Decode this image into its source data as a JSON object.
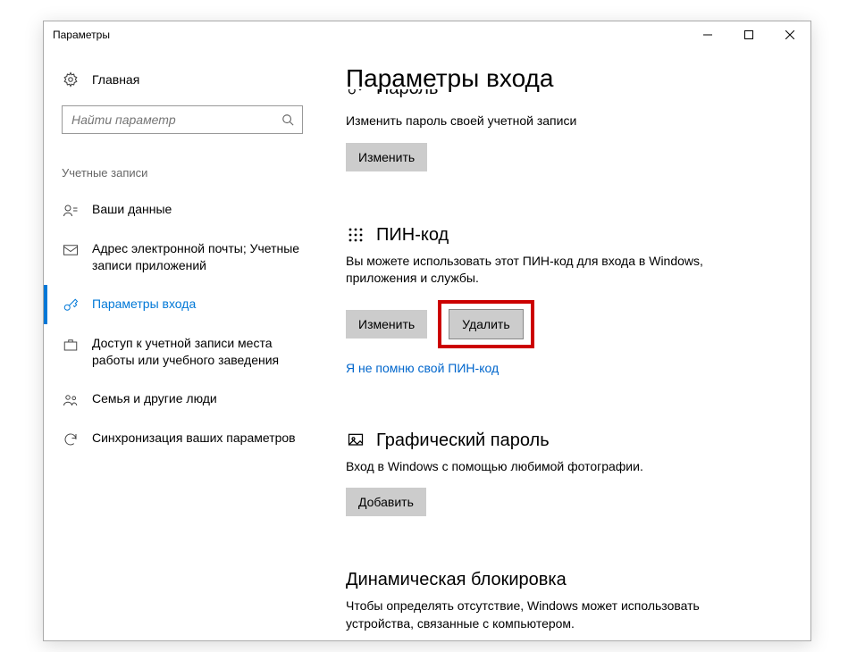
{
  "titlebar": {
    "title": "Параметры"
  },
  "sidebar": {
    "home": "Главная",
    "search_placeholder": "Найти параметр",
    "group": "Учетные записи",
    "items": [
      {
        "label": "Ваши данные"
      },
      {
        "label": "Адрес электронной почты; Учетные записи приложений"
      },
      {
        "label": "Параметры входа"
      },
      {
        "label": "Доступ к учетной записи места работы или учебного заведения"
      },
      {
        "label": "Семья и другие люди"
      },
      {
        "label": "Синхронизация ваших параметров"
      }
    ]
  },
  "main": {
    "page_title": "Параметры входа",
    "password": {
      "heading_partial": "Пароль",
      "desc": "Изменить пароль своей учетной записи",
      "change": "Изменить"
    },
    "pin": {
      "heading": "ПИН-код",
      "desc": "Вы можете использовать этот ПИН-код для входа в Windows, приложения и службы.",
      "change": "Изменить",
      "remove": "Удалить",
      "forgot": "Я не помню свой ПИН-код"
    },
    "picture": {
      "heading": "Графический пароль",
      "desc": "Вход в Windows с помощью любимой фотографии.",
      "add": "Добавить"
    },
    "dynamic": {
      "heading": "Динамическая блокировка",
      "desc": "Чтобы определять отсутствие, Windows может использовать устройства, связанные с компьютером."
    }
  }
}
